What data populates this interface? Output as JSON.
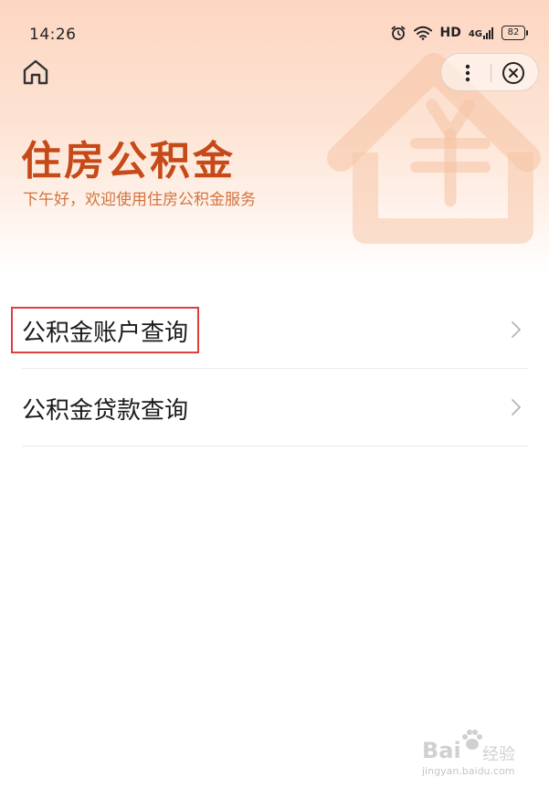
{
  "status_bar": {
    "time": "14:26",
    "icons": [
      "alarm-icon",
      "wifi-icon",
      "hd-indicator",
      "signal-4g-icon",
      "battery-icon"
    ],
    "hd_text": "HD",
    "network_text": "4G",
    "battery_level": "82"
  },
  "header": {
    "home_icon": "home-icon",
    "capsule": {
      "more_icon": "more-vertical-icon",
      "close_icon": "close-circle-icon"
    }
  },
  "hero": {
    "title": "住房公积金",
    "subtitle": "下午好，欢迎使用住房公积金服务",
    "decoration_icon": "house-yuan-icon",
    "title_color": "#c64a17",
    "subtitle_color": "#d2733f"
  },
  "menu": {
    "items": [
      {
        "label": "公积金账户查询",
        "icon": "chevron-right-icon"
      },
      {
        "label": "公积金贷款查询",
        "icon": "chevron-right-icon"
      }
    ]
  },
  "annotation": {
    "highlight_color": "#e23d3d"
  },
  "watermark": {
    "brand": "Bai",
    "brand_suffix": "经验",
    "url": "jingyan.baidu.com"
  }
}
